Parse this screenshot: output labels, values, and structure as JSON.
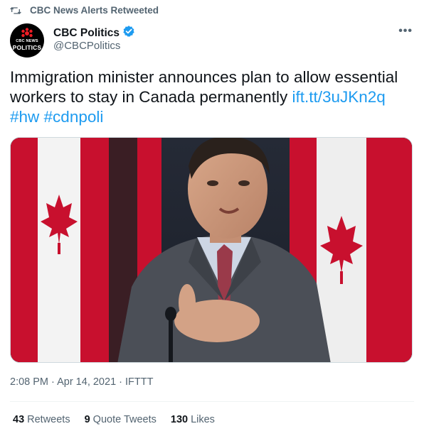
{
  "retweet": {
    "label": "CBC News Alerts Retweeted"
  },
  "author": {
    "name": "CBC Politics",
    "handle": "@CBCPolitics",
    "avatar_brand": "CBC NEWS",
    "avatar_section": "POLITICS",
    "verified": true
  },
  "tweet": {
    "text_line1": "Immigration minister announces plan to allow essential",
    "text_line2": "workers to stay in Canada permanently",
    "link": "ift.tt/3uJKn2q",
    "hashtag1": "#hw",
    "hashtag2": "#cdnpoli",
    "link_color": "#1d9bf0"
  },
  "meta": {
    "time": "2:08 PM",
    "date": "Apr 14, 2021",
    "source": "IFTTT"
  },
  "stats": {
    "retweets_count": "43",
    "retweets_label": "Retweets",
    "quotes_count": "9",
    "quotes_label": "Quote Tweets",
    "likes_count": "130",
    "likes_label": "Likes"
  },
  "icons": {
    "retweet": "retweet-icon",
    "verified": "verified-badge-icon",
    "more": "more-icon"
  },
  "colors": {
    "text": "#0f1419",
    "secondary": "#536471",
    "accent": "#1d9bf0"
  }
}
